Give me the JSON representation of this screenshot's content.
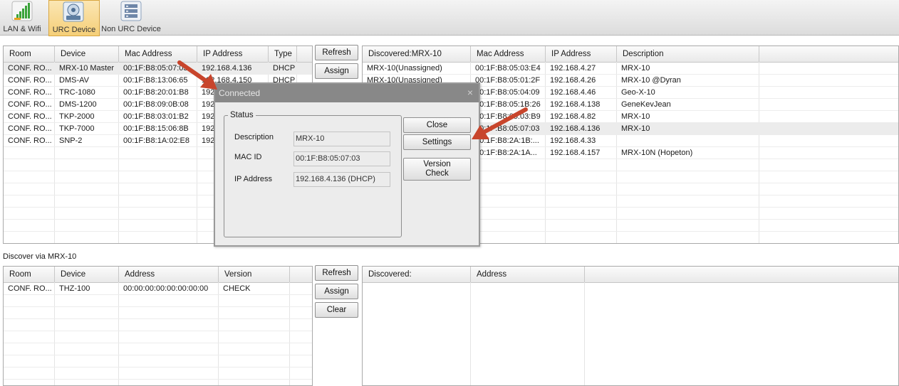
{
  "toolbar": {
    "items": [
      {
        "label": "LAN & Wifi",
        "icon": "signal-bars-icon"
      },
      {
        "label": "URC Device",
        "icon": "router-device-icon",
        "active": true
      },
      {
        "label": "Non URC Device",
        "icon": "server-rack-icon"
      }
    ]
  },
  "top_devices": {
    "headers": [
      "Room",
      "Device",
      "Mac Address",
      "IP Address",
      "Type"
    ],
    "rows": [
      [
        "CONF. RO...",
        "MRX-10 Master",
        "00:1F:B8:05:07:03",
        "192.168.4.136",
        "DHCP"
      ],
      [
        "CONF. RO...",
        "DMS-AV",
        "00:1F:B8:13:06:65",
        "192.168.4.150",
        "DHCP"
      ],
      [
        "CONF. RO...",
        "TRC-1080",
        "00:1F:B8:20:01:B8",
        "192",
        ""
      ],
      [
        "CONF. RO...",
        "DMS-1200",
        "00:1F:B8:09:0B:08",
        "192",
        ""
      ],
      [
        "CONF. RO...",
        "TKP-2000",
        "00:1F:B8:03:01:B2",
        "192",
        ""
      ],
      [
        "CONF. RO...",
        "TKP-7000",
        "00:1F:B8:15:06:8B",
        "192",
        ""
      ],
      [
        "CONF. RO...",
        "SNP-2",
        "00:1F:B8:1A:02:E8",
        "192",
        ""
      ]
    ]
  },
  "top_buttons": {
    "refresh": "Refresh",
    "assign": "Assign"
  },
  "discovered_top": {
    "headers": [
      "Discovered:MRX-10",
      "Mac Address",
      "IP Address",
      "Description"
    ],
    "rows": [
      [
        "MRX-10(Unassigned)",
        "00:1F:B8:05:03:E4",
        "192.168.4.27",
        "MRX-10"
      ],
      [
        "MRX-10(Unassigned)",
        "00:1F:B8:05:01:2F",
        "192.168.4.26",
        "MRX-10 @Dyran"
      ],
      [
        "",
        "00:1F:B8:05:04:09",
        "192.168.4.46",
        "Geo-X-10"
      ],
      [
        "",
        "00:1F:B8:05:1B:26",
        "192.168.4.138",
        "GeneKevJean"
      ],
      [
        "",
        "00:1F:B8:05:03:B9",
        "192.168.4.82",
        "MRX-10"
      ],
      [
        "",
        "00:1F:B8:05:07:03",
        "192.168.4.136",
        "MRX-10"
      ],
      [
        "",
        "00:1F:B8:2A:1B:...",
        "192.168.4.33",
        ""
      ],
      [
        "",
        "00:1F:B8:2A:1A...",
        "192.168.4.157",
        "MRX-10N (Hopeton)"
      ]
    ]
  },
  "section_label": "Discover via MRX-10",
  "bottom_devices": {
    "headers": [
      "Room",
      "Device",
      "Address",
      "Version"
    ],
    "rows": [
      [
        "CONF. RO...",
        "THZ-100",
        "00:00:00:00:00:00:00:00",
        "CHECK"
      ]
    ]
  },
  "bottom_buttons": {
    "refresh": "Refresh",
    "assign": "Assign",
    "clear": "Clear"
  },
  "discovered_bottom": {
    "headers": [
      "Discovered:",
      "Address"
    ]
  },
  "dialog": {
    "title": "Connected",
    "close_glyph": "×",
    "status_legend": "Status",
    "fields": [
      {
        "label": "Description",
        "value": "MRX-10"
      },
      {
        "label": "MAC ID",
        "value": "00:1F:B8:05:07:03"
      },
      {
        "label": "IP Address",
        "value": "192.168.4.136 (DHCP)"
      }
    ],
    "buttons": {
      "close": "Close",
      "settings": "Settings",
      "version_line1": "Version",
      "version_line2": "Check"
    }
  },
  "colors": {
    "annotation_arrow": "#c8452c",
    "active_tab": "#f5cf78"
  }
}
